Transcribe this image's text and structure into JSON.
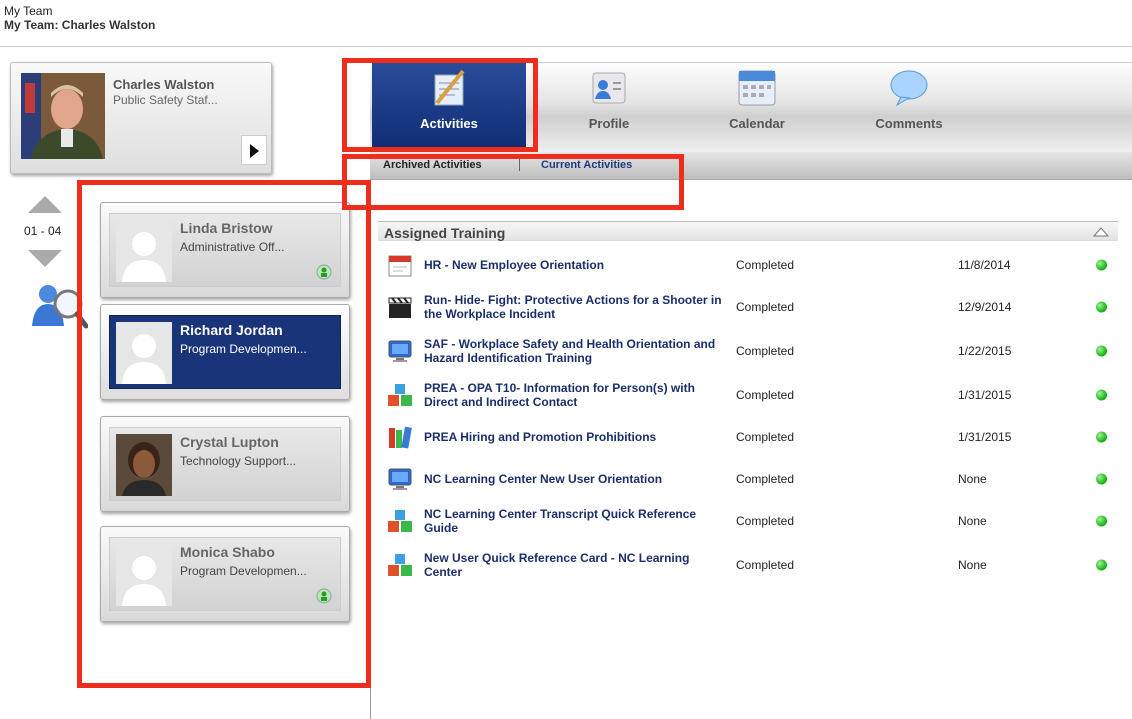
{
  "header": {
    "title": "My Team",
    "subtitle": "My Team: Charles Walston"
  },
  "selected_person": {
    "name": "Charles Walston",
    "role": "Public Safety Staf..."
  },
  "pager": {
    "range": "01 - 04"
  },
  "team": [
    {
      "name": "Linda Bristow",
      "role": "Administrative Off...",
      "has_photo": false,
      "online_icon": true,
      "selected": false
    },
    {
      "name": "Richard Jordan",
      "role": "Program Developmen...",
      "has_photo": false,
      "online_icon": false,
      "selected": true
    },
    {
      "name": "Crystal Lupton",
      "role": "Technology Support...",
      "has_photo": true,
      "online_icon": false,
      "selected": false
    },
    {
      "name": "Monica Shabo",
      "role": "Program Developmen...",
      "has_photo": false,
      "online_icon": true,
      "selected": false
    }
  ],
  "nav": {
    "tabs": [
      {
        "label": "Activities",
        "icon": "activities-icon",
        "active": true
      },
      {
        "label": "Profile",
        "icon": "profile-icon",
        "active": false
      },
      {
        "label": "Calendar",
        "icon": "calendar-icon",
        "active": false
      },
      {
        "label": "Comments",
        "icon": "comments-icon",
        "active": false
      }
    ],
    "sub_links": {
      "archived": "Archived Activities",
      "current": "Current Activities"
    }
  },
  "training": {
    "section_title": "Assigned Training",
    "rows": [
      {
        "course": "HR - New Employee Orientation",
        "status": "Completed",
        "date": "11/8/2014",
        "icon": "calendar-event-icon"
      },
      {
        "course": "Run- Hide- Fight: Protective Actions for a Shooter in the Workplace Incident",
        "status": "Completed",
        "date": "12/9/2014",
        "icon": "clapperboard-icon"
      },
      {
        "course": "SAF - Workplace Safety and Health Orientation and Hazard Identification Training",
        "status": "Completed",
        "date": "1/22/2015",
        "icon": "monitor-icon"
      },
      {
        "course": "PREA - OPA T10- Information for Person(s) with Direct and Indirect Contact",
        "status": "Completed",
        "date": "1/31/2015",
        "icon": "cubes-icon"
      },
      {
        "course": "PREA Hiring and Promotion Prohibitions",
        "status": "Completed",
        "date": "1/31/2015",
        "icon": "books-icon"
      },
      {
        "course": "NC Learning Center New User Orientation",
        "status": "Completed",
        "date": "None",
        "icon": "monitor-icon"
      },
      {
        "course": "NC Learning Center Transcript Quick Reference Guide",
        "status": "Completed",
        "date": "None",
        "icon": "cubes-icon"
      },
      {
        "course": "New User Quick Reference Card - NC Learning Center",
        "status": "Completed",
        "date": "None",
        "icon": "cubes-icon"
      }
    ]
  },
  "colors": {
    "accent_blue": "#1a347a",
    "annotation_red": "#ee2d1c",
    "status_green": "#21b81c"
  }
}
